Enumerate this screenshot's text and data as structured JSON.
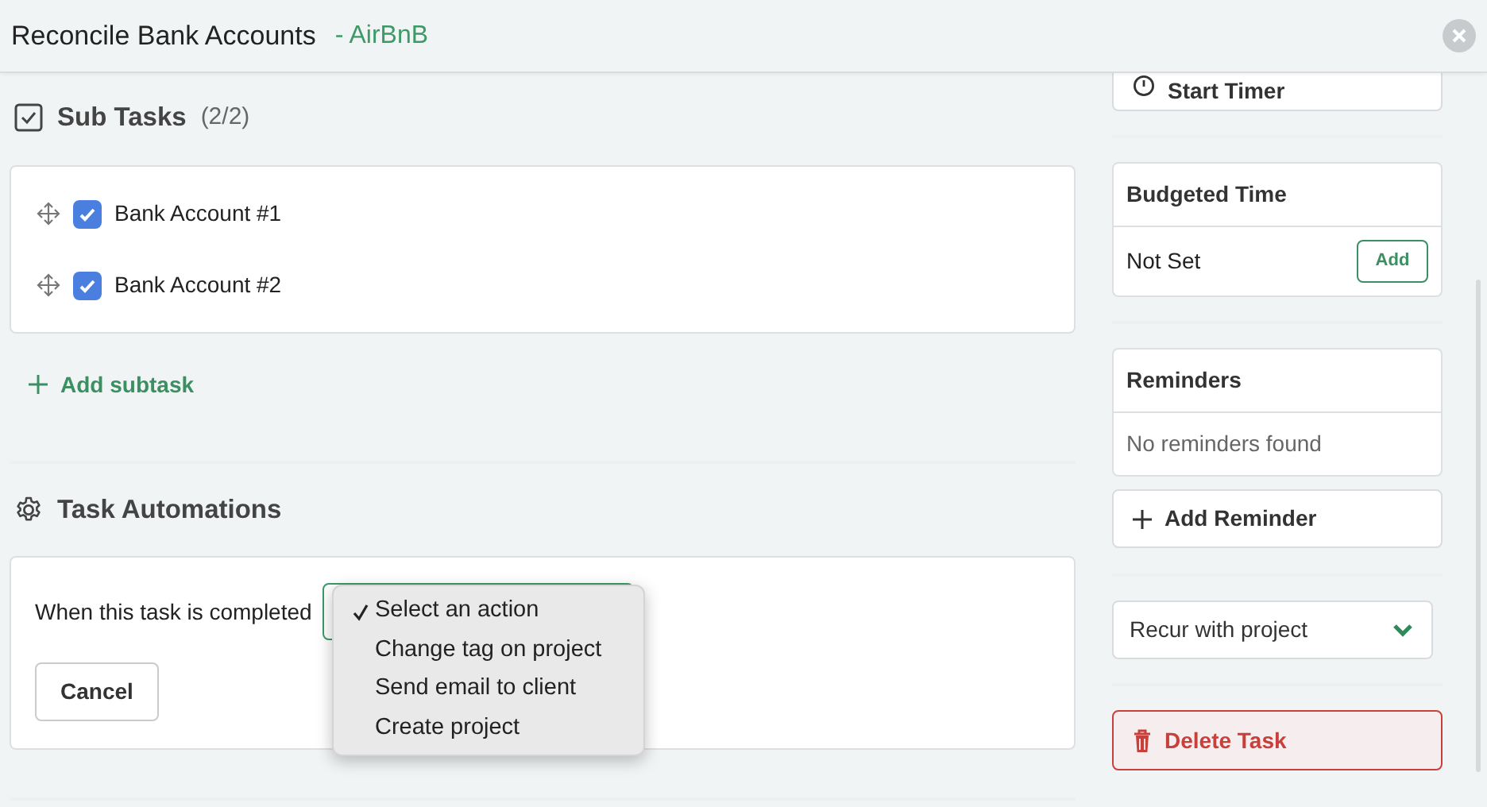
{
  "header": {
    "title": "Reconcile Bank Accounts",
    "client": "- AirBnB"
  },
  "subtasks": {
    "title": "Sub Tasks",
    "count": "(2/2)",
    "items": [
      {
        "label": "Bank Account #1",
        "checked": true
      },
      {
        "label": "Bank Account #2",
        "checked": true
      }
    ],
    "add_label": "Add subtask"
  },
  "automations": {
    "title": "Task Automations",
    "label": "When this task is completed",
    "menu": [
      {
        "label": "Select an action",
        "selected": true
      },
      {
        "label": "Change tag on project",
        "selected": false
      },
      {
        "label": "Send email to client",
        "selected": false
      },
      {
        "label": "Create project",
        "selected": false
      }
    ],
    "cancel": "Cancel"
  },
  "sidebar": {
    "timer": "Start Timer",
    "budget": {
      "title": "Budgeted Time",
      "value": "Not Set",
      "button": "Add"
    },
    "reminders": {
      "title": "Reminders",
      "empty": "No reminders found",
      "add": "Add Reminder"
    },
    "recur": "Recur with project",
    "delete": "Delete Task"
  }
}
